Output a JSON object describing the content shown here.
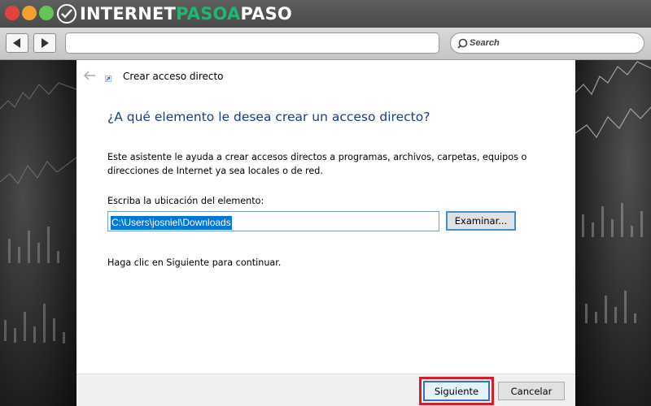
{
  "browser": {
    "brand": {
      "part1": "INTERNET",
      "part2": "PASOA",
      "part3": "PASO"
    },
    "search_placeholder": "Search",
    "colors": {
      "close": "#e0443e",
      "minimize": "#f0a030",
      "maximize": "#62c554",
      "brand_accent": "#22b573"
    }
  },
  "dialog": {
    "title": "Crear acceso directo",
    "heading": "¿A qué elemento le desea crear un acceso directo?",
    "description": "Este asistente le ayuda a crear accesos directos a programas, archivos, carpetas, equipos o direcciones de Internet ya sea locales o de red.",
    "location_label": "Escriba la ubicación del elemento:",
    "location_value": "C:\\Users\\josniel\\Downloads",
    "browse_label": "Examinar...",
    "hint": "Haga clic en Siguiente para continuar.",
    "next_label": "Siguiente",
    "cancel_label": "Cancelar",
    "colors": {
      "heading": "#1b3c8c",
      "selection": "#0078d7",
      "highlight_frame": "#d21f2a"
    }
  }
}
